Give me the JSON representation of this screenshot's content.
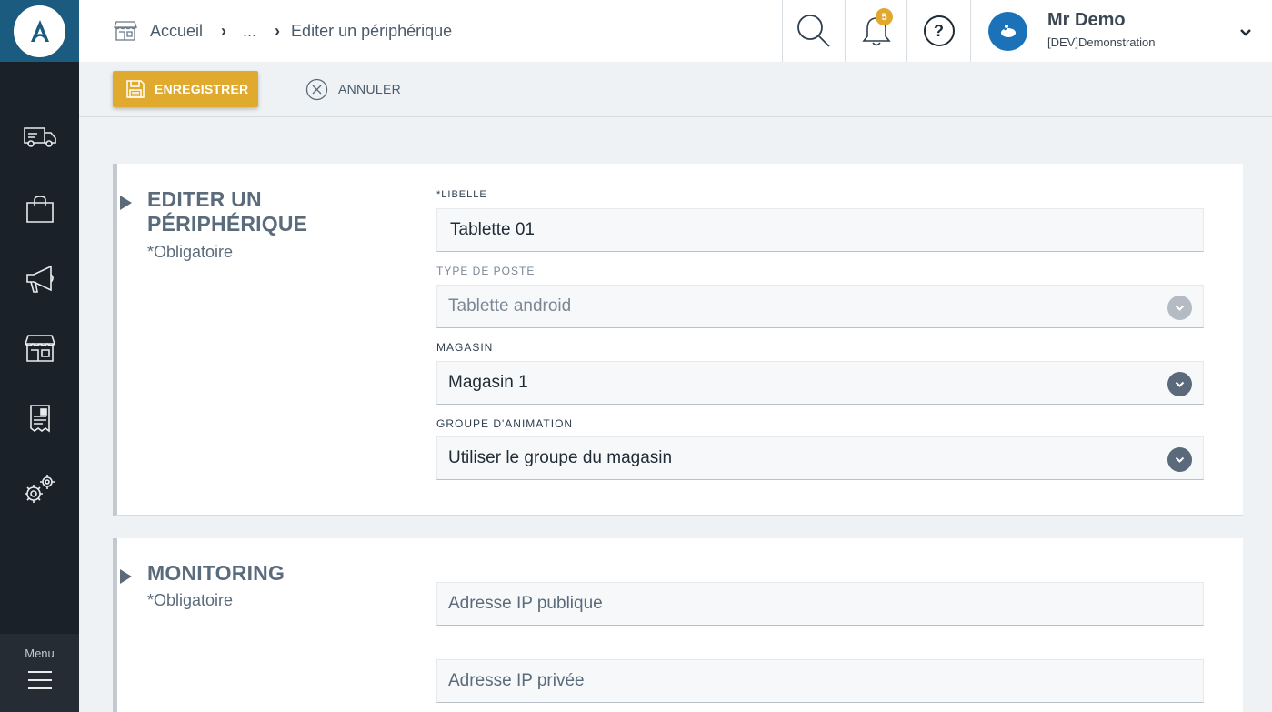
{
  "app": {
    "logo_letter": "A",
    "brand_color": "#1c5b80",
    "accent_color": "#e0aa2e"
  },
  "sidebar": {
    "items": [
      {
        "icon": "delivery-truck-icon"
      },
      {
        "icon": "shopping-bag-icon"
      },
      {
        "icon": "megaphone-icon"
      },
      {
        "icon": "store-icon"
      },
      {
        "icon": "invoice-icon"
      },
      {
        "icon": "settings-gears-icon"
      }
    ],
    "menu_label": "Menu"
  },
  "header": {
    "breadcrumb": {
      "home": "Accueil",
      "ellipsis": "...",
      "current": "Editer un périphérique"
    },
    "notifications_count": "5",
    "help_symbol": "?",
    "user": {
      "name": "Mr Demo",
      "org": "[DEV]Demonstration"
    }
  },
  "toolbar": {
    "save_label": "ENREGISTRER",
    "cancel_label": "ANNULER"
  },
  "section_edit": {
    "title_line1": "EDITER UN",
    "title_line2": "PÉRIPHÉRIQUE",
    "required_note": "*Obligatoire",
    "fields": {
      "libelle_label": "*LIBELLE",
      "libelle_value": "Tablette 01",
      "type_poste_label": "TYPE DE POSTE",
      "type_poste_value": "Tablette android",
      "magasin_label": "MAGASIN",
      "magasin_value": "Magasin 1",
      "groupe_label": "GROUPE D'ANIMATION",
      "groupe_value": "Utiliser le groupe du magasin"
    }
  },
  "section_monitoring": {
    "title": "MONITORING",
    "required_note": "*Obligatoire",
    "fields": {
      "ip_public_placeholder": "Adresse IP publique",
      "ip_private_placeholder": "Adresse IP privée"
    }
  }
}
